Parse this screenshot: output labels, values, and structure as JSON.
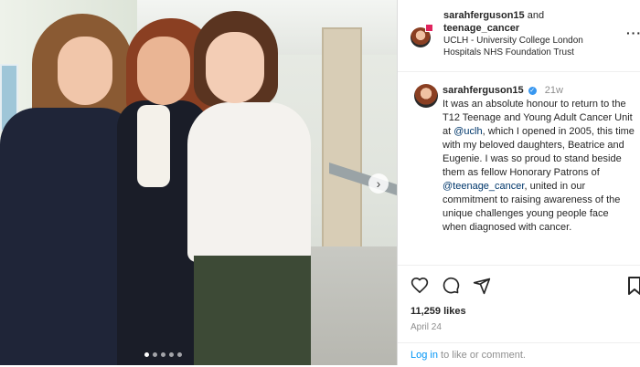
{
  "post": {
    "header": {
      "username": "sarahferguson15",
      "and": "and",
      "collaborator": "teenage_cancer",
      "location_line1": "UCLH - University College London",
      "location_line2": "Hospitals NHS Foundation Trust",
      "more_icon": "more-horizontal-icon"
    },
    "caption": {
      "username": "sarahferguson15",
      "time": "21w",
      "text_1": "It was an absolute honour to return to the T12 Teenage and Young Adult Cancer Unit at ",
      "mention_1": "@uclh",
      "text_2": ", which I opened in 2005, this time with my beloved daughters, Beatrice and Eugenie. I was so proud to stand beside them as fellow Honorary Patrons of ",
      "mention_2": "@teenage_cancer",
      "text_3": ", united in our commitment to raising awareness of the unique challenges young people face when diagnosed with cancer."
    },
    "likes": "11,259 likes",
    "date": "April 24",
    "login_link": "Log in",
    "login_rest": " to like or comment.",
    "icons": [
      "heart-icon",
      "comment-icon",
      "share-icon",
      "bookmark-icon"
    ],
    "carousel": {
      "count": 5,
      "active": 0
    }
  },
  "colors": {
    "link": "#00376b",
    "accent": "#0095f6",
    "verified": "#3897f0"
  }
}
